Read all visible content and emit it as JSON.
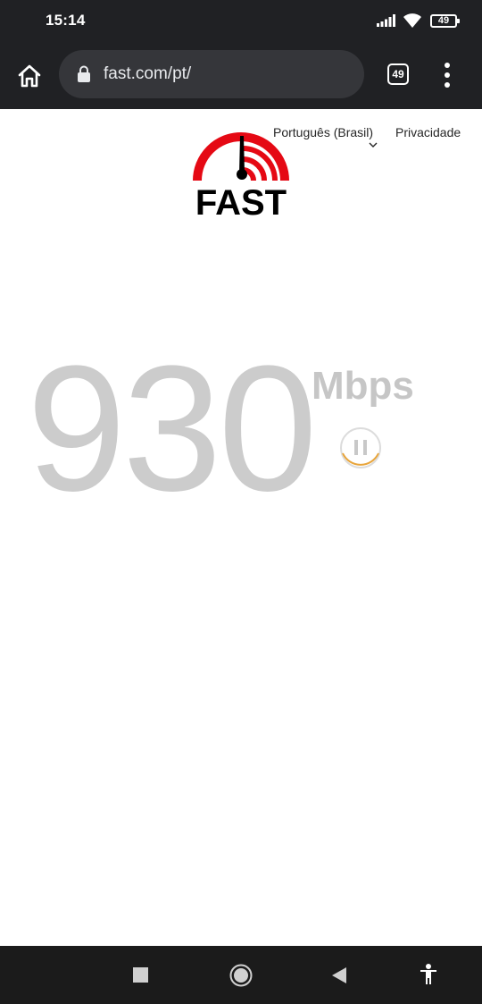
{
  "status_bar": {
    "time": "15:14",
    "battery_level": "49",
    "icons": [
      "signal-icon",
      "wifi-icon",
      "battery-icon"
    ]
  },
  "browser": {
    "url": "fast.com/pt/",
    "tab_count": "49",
    "icons": [
      "home-icon",
      "lock-icon",
      "tabs-icon",
      "overflow-menu-icon"
    ]
  },
  "page": {
    "logo_text": "FAST",
    "nav": {
      "language": "Português (Brasil)",
      "privacy": "Privacidade"
    },
    "speed": {
      "value": "930",
      "unit": "Mbps"
    },
    "colors": {
      "brand_red": "#e50914",
      "speed_gray": "#cccccc",
      "pause_ring": "#e8a53b"
    }
  },
  "system_nav": {
    "icons": [
      "recents-square-icon",
      "home-circle-icon",
      "back-triangle-icon",
      "accessibility-icon"
    ]
  }
}
